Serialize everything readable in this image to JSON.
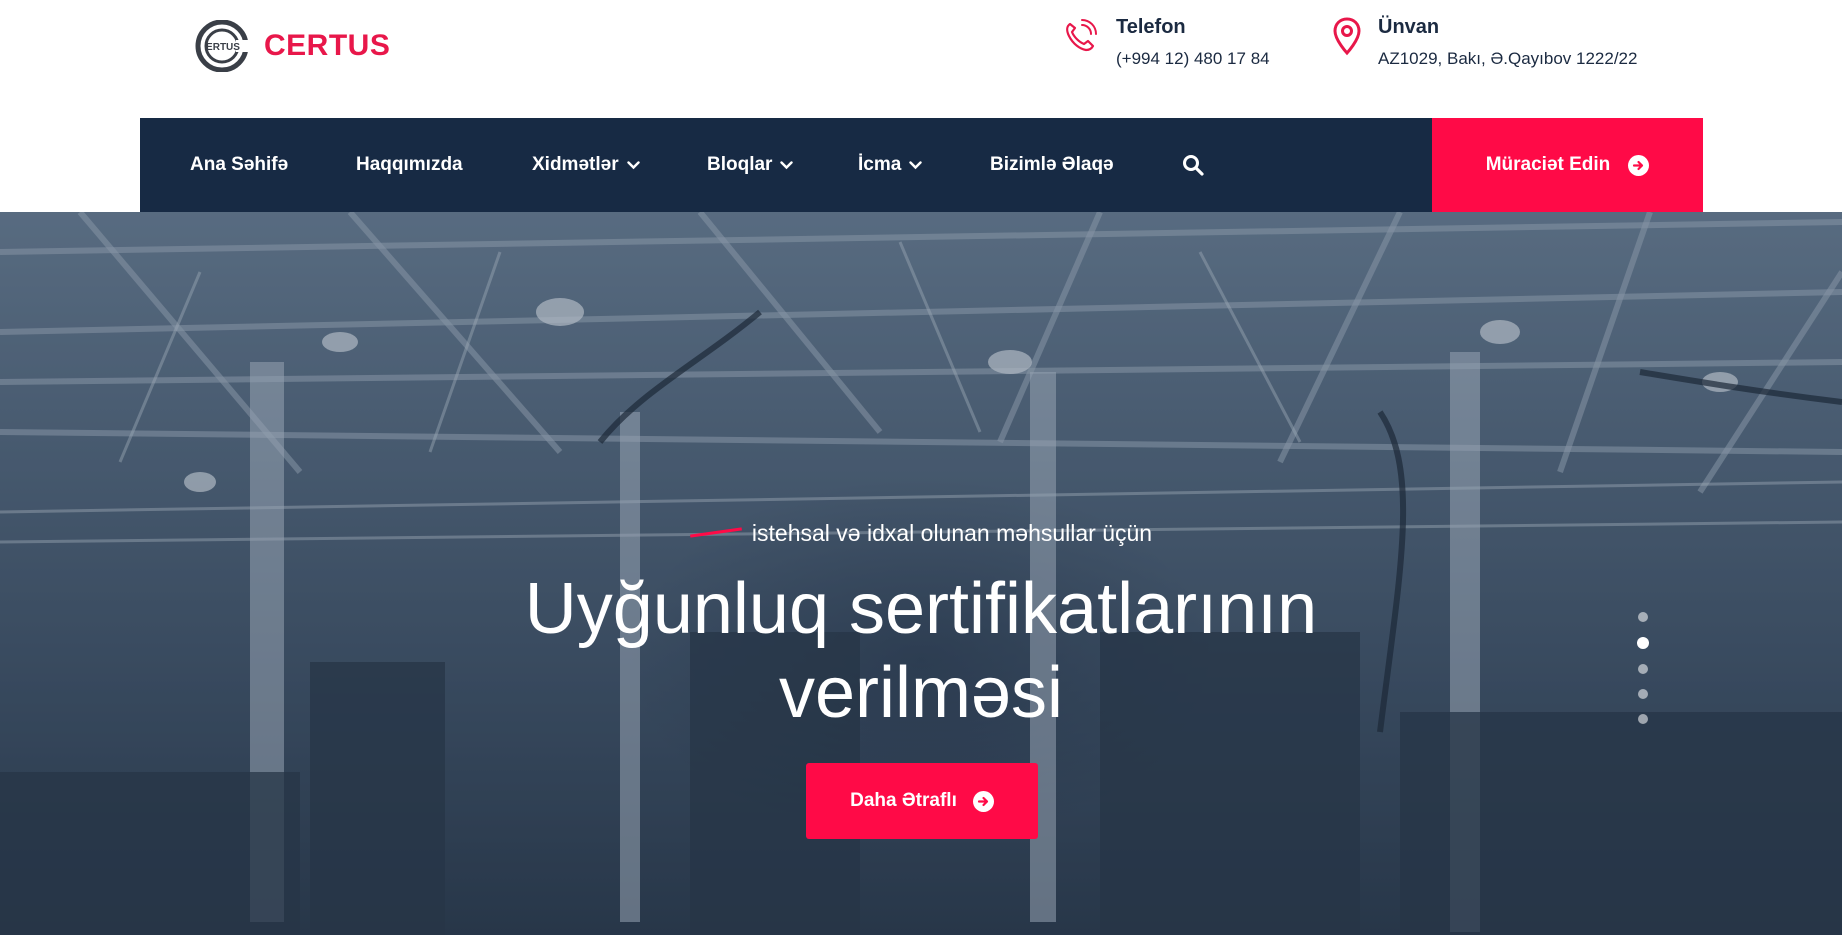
{
  "brand": {
    "logo_mark_text": "ERTUS",
    "name": "CERTUS",
    "accent_color": "#ff0a47",
    "navy_color": "#172a44"
  },
  "header": {
    "phone": {
      "icon": "phone-icon",
      "title": "Telefon",
      "value": "(+994 12) 480 17 84"
    },
    "address": {
      "icon": "location-pin-icon",
      "title": "Ünvan",
      "value": "AZ1029, Bakı, Ə.Qayıbov 1222/22"
    }
  },
  "nav": {
    "items": [
      {
        "label": "Ana Səhifə",
        "has_dropdown": false
      },
      {
        "label": "Haqqımızda",
        "has_dropdown": false
      },
      {
        "label": "Xidmətlər",
        "has_dropdown": true
      },
      {
        "label": "Bloqlar",
        "has_dropdown": true
      },
      {
        "label": "İcma",
        "has_dropdown": true
      },
      {
        "label": "Bizimlə Əlaqə",
        "has_dropdown": false
      }
    ],
    "search_icon": "search-icon",
    "cta_label": "Müraciət Edin",
    "cta_icon": "arrow-circle-right-icon"
  },
  "hero": {
    "eyebrow": "istehsal və idxal olunan məhsullar üçün",
    "title_line1": "Uyğunluq sertifikatlarının",
    "title_line2": "verilməsi",
    "button_label": "Daha Ətraflı",
    "button_icon": "arrow-circle-right-icon",
    "slides_total": 5,
    "active_slide": 1
  }
}
